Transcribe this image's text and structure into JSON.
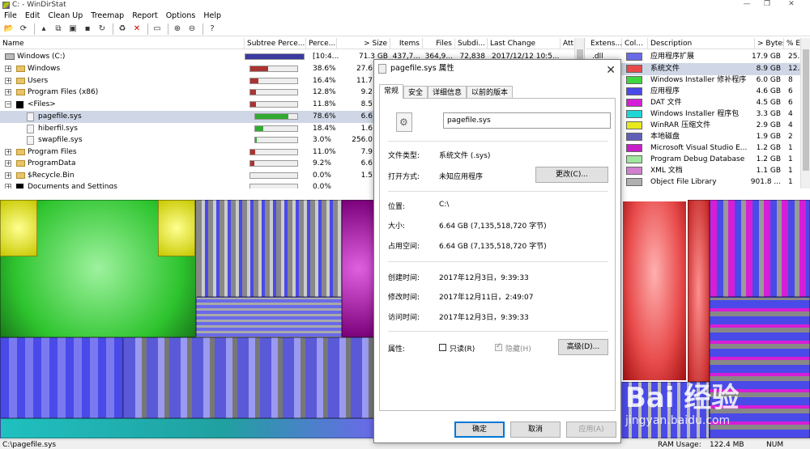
{
  "window": {
    "title": "C: - WinDirStat",
    "minimize": "—",
    "maximize": "❐",
    "close": "✕"
  },
  "menu": [
    "File",
    "Edit",
    "Clean Up",
    "Treemap",
    "Report",
    "Options",
    "Help"
  ],
  "tree": {
    "columns": [
      "Name",
      "Subtree Perce...",
      "Perce...",
      "> Size",
      "Items",
      "Files",
      "Subdi...",
      "Last Change",
      "Att"
    ],
    "root": {
      "name": "Windows (C:)",
      "percent": "[10:4...",
      "size": "71.3 GB",
      "items": "437,7...",
      "files": "364,9...",
      "subdirs": "72,838",
      "last_change": "2017/12/12  10:5...",
      "subtree_fraction": 1.0
    },
    "rows": [
      {
        "name": "Windows",
        "percent": "38.6%",
        "size": "27.6",
        "subtree_fraction": 0.386,
        "kind": "folder",
        "expand": "+"
      },
      {
        "name": "Users",
        "percent": "16.4%",
        "size": "11.7",
        "subtree_fraction": 0.164,
        "kind": "folder",
        "expand": "+"
      },
      {
        "name": "Program Files (x86)",
        "percent": "12.8%",
        "size": "9.2",
        "subtree_fraction": 0.128,
        "kind": "folder",
        "expand": "+"
      },
      {
        "name": "<Files>",
        "percent": "11.8%",
        "size": "8.5",
        "subtree_fraction": 0.118,
        "kind": "files",
        "expand": "−"
      },
      {
        "name": "pagefile.sys",
        "percent": "78.6%",
        "size": "6.6",
        "subtree_fraction": 0.786,
        "kind": "file",
        "selected": true
      },
      {
        "name": "hiberfil.sys",
        "percent": "18.4%",
        "size": "1.6",
        "subtree_fraction": 0.184,
        "kind": "file"
      },
      {
        "name": "swapfile.sys",
        "percent": "3.0%",
        "size": "256.0",
        "subtree_fraction": 0.03,
        "kind": "file"
      },
      {
        "name": "Program Files",
        "percent": "11.0%",
        "size": "7.9",
        "subtree_fraction": 0.11,
        "kind": "folder",
        "expand": "+"
      },
      {
        "name": "ProgramData",
        "percent": "9.2%",
        "size": "6.6",
        "subtree_fraction": 0.092,
        "kind": "folder",
        "expand": "+"
      },
      {
        "name": "$Recycle.Bin",
        "percent": "0.0%",
        "size": "1.5",
        "subtree_fraction": 0.0,
        "kind": "folder",
        "expand": "+"
      },
      {
        "name": "Documents and Settings",
        "percent": "0.0%",
        "size": "",
        "subtree_fraction": 0.0,
        "kind": "special",
        "expand": "+"
      }
    ]
  },
  "extensions": {
    "columns": [
      "Extens...",
      "Col...",
      "Description",
      "> Bytes",
      "% E"
    ],
    "rows": [
      {
        "ext": ".dll",
        "color": "#6a6ae8",
        "desc": "应用程序扩展",
        "bytes": "17.9 GB",
        "pct": "25."
      },
      {
        "ext": "",
        "color": "#e84a4a",
        "desc": "系统文件",
        "bytes": "8.9 GB",
        "pct": "12.",
        "selected": true
      },
      {
        "ext": "",
        "color": "#3fd63f",
        "desc": "Windows Installer 修补程序",
        "bytes": "6.0 GB",
        "pct": "8"
      },
      {
        "ext": "",
        "color": "#4a4ae8",
        "desc": "应用程序",
        "bytes": "4.6 GB",
        "pct": "6"
      },
      {
        "ext": "",
        "color": "#d61ed6",
        "desc": "DAT 文件",
        "bytes": "4.5 GB",
        "pct": "6"
      },
      {
        "ext": "",
        "color": "#1ed6d6",
        "desc": "Windows Installer 程序包",
        "bytes": "3.3 GB",
        "pct": "4"
      },
      {
        "ext": "",
        "color": "#e8e81e",
        "desc": "WinRAR 压缩文件",
        "bytes": "2.9 GB",
        "pct": "4"
      },
      {
        "ext": "",
        "color": "#6060b8",
        "desc": "本地磁盘",
        "bytes": "1.9 GB",
        "pct": "2"
      },
      {
        "ext": "",
        "color": "#c81ec8",
        "desc": "Microsoft Visual Studio E...",
        "bytes": "1.2 GB",
        "pct": "1"
      },
      {
        "ext": "",
        "color": "#9ee89e",
        "desc": "Program Debug Database",
        "bytes": "1.2 GB",
        "pct": "1"
      },
      {
        "ext": "",
        "color": "#d080d0",
        "desc": "XML 文档",
        "bytes": "1.1 GB",
        "pct": "1"
      },
      {
        "ext": "",
        "color": "#b0b0b0",
        "desc": "Object File Library",
        "bytes": "901.8 ...",
        "pct": "1"
      }
    ]
  },
  "dialog": {
    "title": "pagefile.sys 属性",
    "close": "✕",
    "tabs": [
      "常规",
      "安全",
      "详细信息",
      "以前的版本"
    ],
    "filename": "pagefile.sys",
    "type_label": "文件类型:",
    "type_value": "系统文件 (.sys)",
    "open_label": "打开方式:",
    "open_value": "未知应用程序",
    "change_button": "更改(C)...",
    "location_label": "位置:",
    "location_value": "C:\\",
    "size_label": "大小:",
    "size_value": "6.64 GB (7,135,518,720 字节)",
    "disk_label": "占用空间:",
    "disk_value": "6.64 GB (7,135,518,720 字节)",
    "created_label": "创建时间:",
    "created_value": "2017年12月3日，9:39:33",
    "modified_label": "修改时间:",
    "modified_value": "2017年12月11日，2:49:07",
    "accessed_label": "访问时间:",
    "accessed_value": "2017年12月3日，9:39:33",
    "attr_label": "属性:",
    "readonly_label": "只读(R)",
    "hidden_label": "隐藏(H)",
    "hidden_checked": true,
    "advanced_button": "高级(D)...",
    "ok_button": "确定",
    "cancel_button": "取消",
    "apply_button": "应用(A)"
  },
  "status": {
    "path": "C:\\pagefile.sys",
    "ram_label": "RAM Usage:",
    "ram_value": "122.4 MB",
    "num": "NUM"
  },
  "watermark": {
    "big": "Bai 经验",
    "small": "jingyan.baidu.com"
  }
}
